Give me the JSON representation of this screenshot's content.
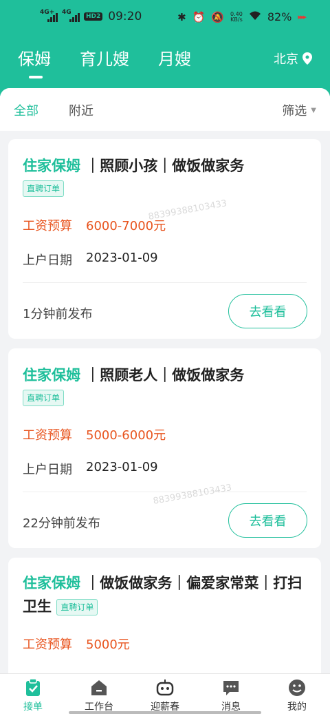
{
  "status": {
    "signal1": "4G+",
    "signal2": "4G",
    "hd": "HD2",
    "time": "09:20",
    "netspeed_top": "0.40",
    "netspeed_bottom": "KB/s",
    "battery": "82%"
  },
  "header": {
    "tabs": [
      "保姆",
      "育儿嫂",
      "月嫂"
    ],
    "city": "北京"
  },
  "subtabs": {
    "all": "全部",
    "nearby": "附近",
    "filter": "筛选"
  },
  "cards": [
    {
      "type": "住家保姆",
      "desc": "｜照顾小孩｜做饭做家务",
      "tag": "直聘订单",
      "salary_label": "工资预算",
      "salary": "6000-7000元",
      "date_label": "上户日期",
      "date": "2023-01-09",
      "posted": "1分钟前发布",
      "action": "去看看"
    },
    {
      "type": "住家保姆",
      "desc": "｜照顾老人｜做饭做家务",
      "tag": "直聘订单",
      "salary_label": "工资预算",
      "salary": "5000-6000元",
      "date_label": "上户日期",
      "date": "2023-01-09",
      "posted": "22分钟前发布",
      "action": "去看看"
    },
    {
      "type": "住家保姆",
      "desc": "｜做饭做家务｜偏爱家常菜｜打扫卫生",
      "tag": "直聘订单",
      "salary_label": "工资预算",
      "salary": "5000元"
    }
  ],
  "watermark": "88399388103433",
  "bottom_nav": [
    {
      "label": "接单",
      "icon": "clipboard-check-icon"
    },
    {
      "label": "工作台",
      "icon": "house-icon"
    },
    {
      "label": "迎薪春",
      "icon": "robot-icon"
    },
    {
      "label": "消息",
      "icon": "chat-bubble-icon"
    },
    {
      "label": "我的",
      "icon": "smiley-face-icon"
    }
  ],
  "colors": {
    "brand": "#1fbf9b",
    "salary": "#e8541e"
  }
}
